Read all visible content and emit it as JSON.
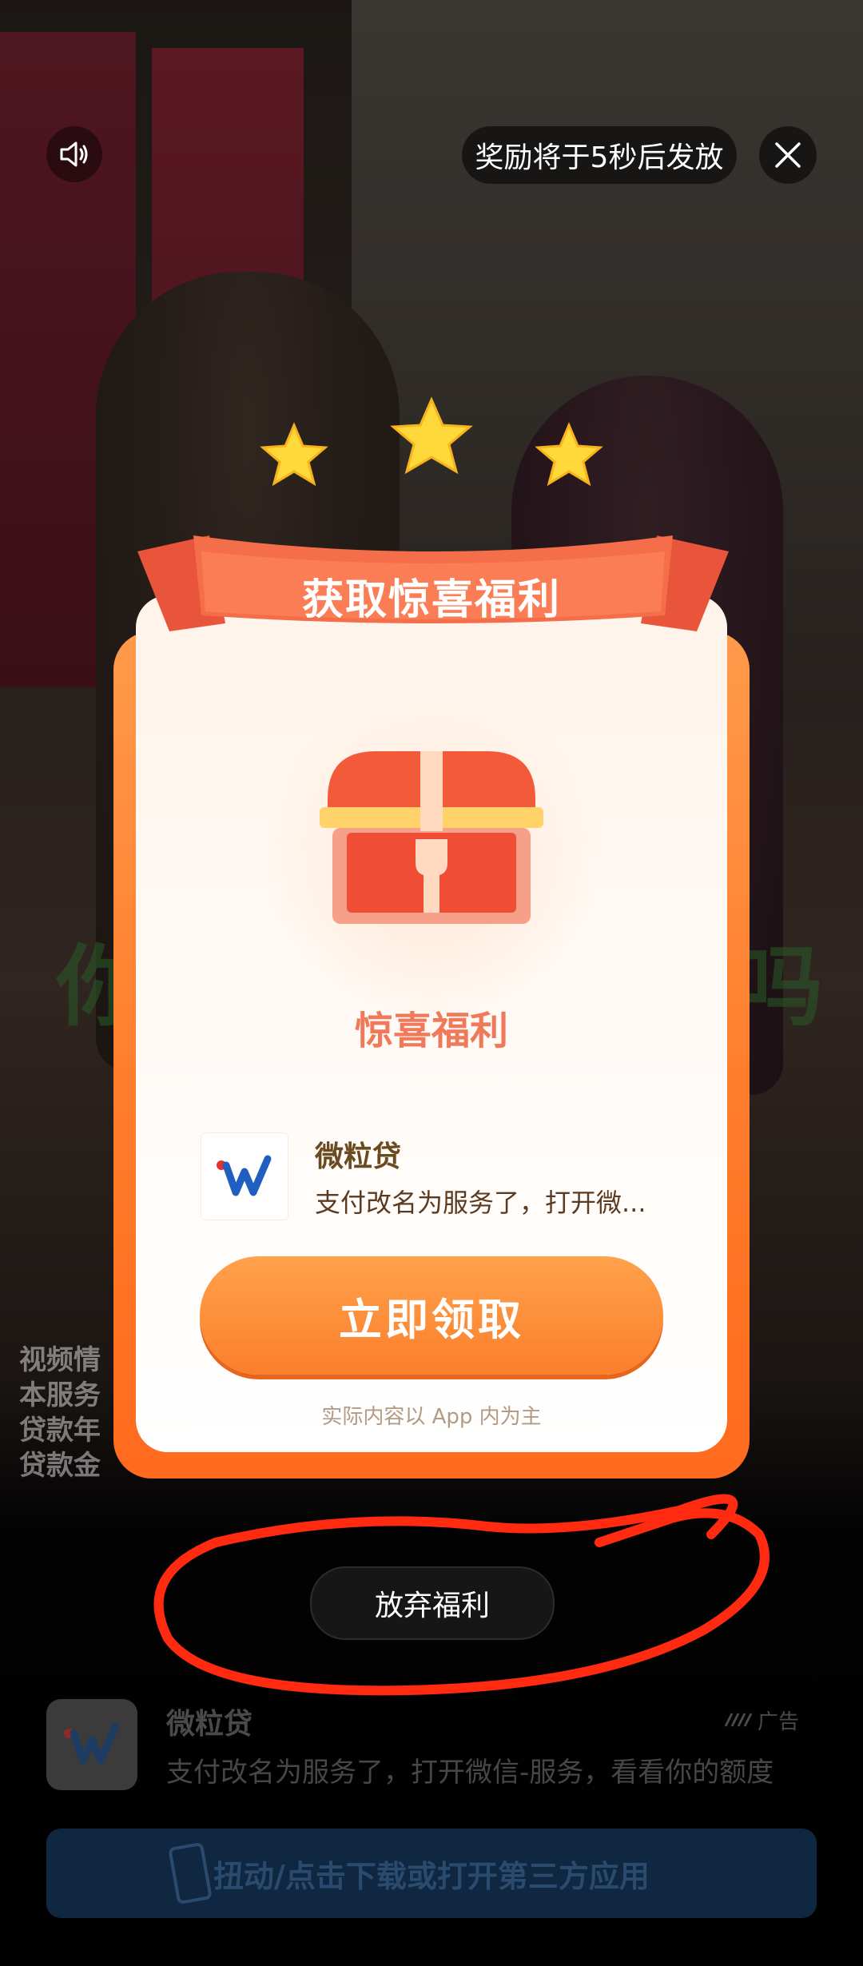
{
  "top_bar": {
    "sound_icon": "speaker-icon",
    "reward_timer_text": "奖励将于5秒后发放",
    "close_icon": "close-icon"
  },
  "background": {
    "caption_lines": [
      "视频情",
      "本服务",
      "贷款年",
      "贷款金"
    ],
    "big_text_left": "你",
    "big_text_right": "吗"
  },
  "dialog": {
    "ribbon_title": "获取惊喜福利",
    "gift_title": "惊喜福利",
    "app": {
      "name": "微粒贷",
      "description": "支付改名为服务了，打开微..."
    },
    "claim_button": "立即领取",
    "disclaimer": "实际内容以 App 内为主",
    "colors": {
      "accent": "#ff7a2a",
      "ribbon": "#f26b4a",
      "gift_title": "#f0795a"
    }
  },
  "give_up_button": "放弃福利",
  "annotation": {
    "color": "#ff2a10"
  },
  "ad_bar": {
    "title": "微粒贷",
    "tag": "广告",
    "description": "支付改名为服务了，打开微信-服务，看看你的额度",
    "cta": "扭动/点击下载或打开第三方应用"
  }
}
